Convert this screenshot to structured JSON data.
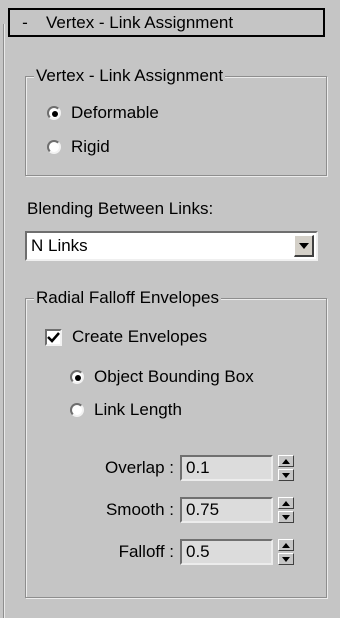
{
  "rollout": {
    "toggle": "-",
    "title": "Vertex - Link Assignment"
  },
  "assignment_group": {
    "legend": "Vertex - Link Assignment",
    "options": [
      {
        "label": "Deformable",
        "selected": true
      },
      {
        "label": "Rigid",
        "selected": false
      }
    ]
  },
  "blending": {
    "label": "Blending Between Links:",
    "selected": "N Links"
  },
  "envelopes_group": {
    "legend": "Radial Falloff Envelopes",
    "create_label": "Create Envelopes",
    "create_checked": true,
    "options": [
      {
        "label": "Object Bounding Box",
        "selected": true
      },
      {
        "label": "Link Length",
        "selected": false
      }
    ],
    "fields": [
      {
        "label": "Overlap :",
        "value": "0.1"
      },
      {
        "label": "Smooth :",
        "value": "0.75"
      },
      {
        "label": "Falloff :",
        "value": "0.5"
      }
    ]
  },
  "icons": {
    "dropdown": "chevron-down-icon",
    "check": "checkmark-icon",
    "spin_up": "triangle-up-icon",
    "spin_down": "triangle-down-icon"
  }
}
